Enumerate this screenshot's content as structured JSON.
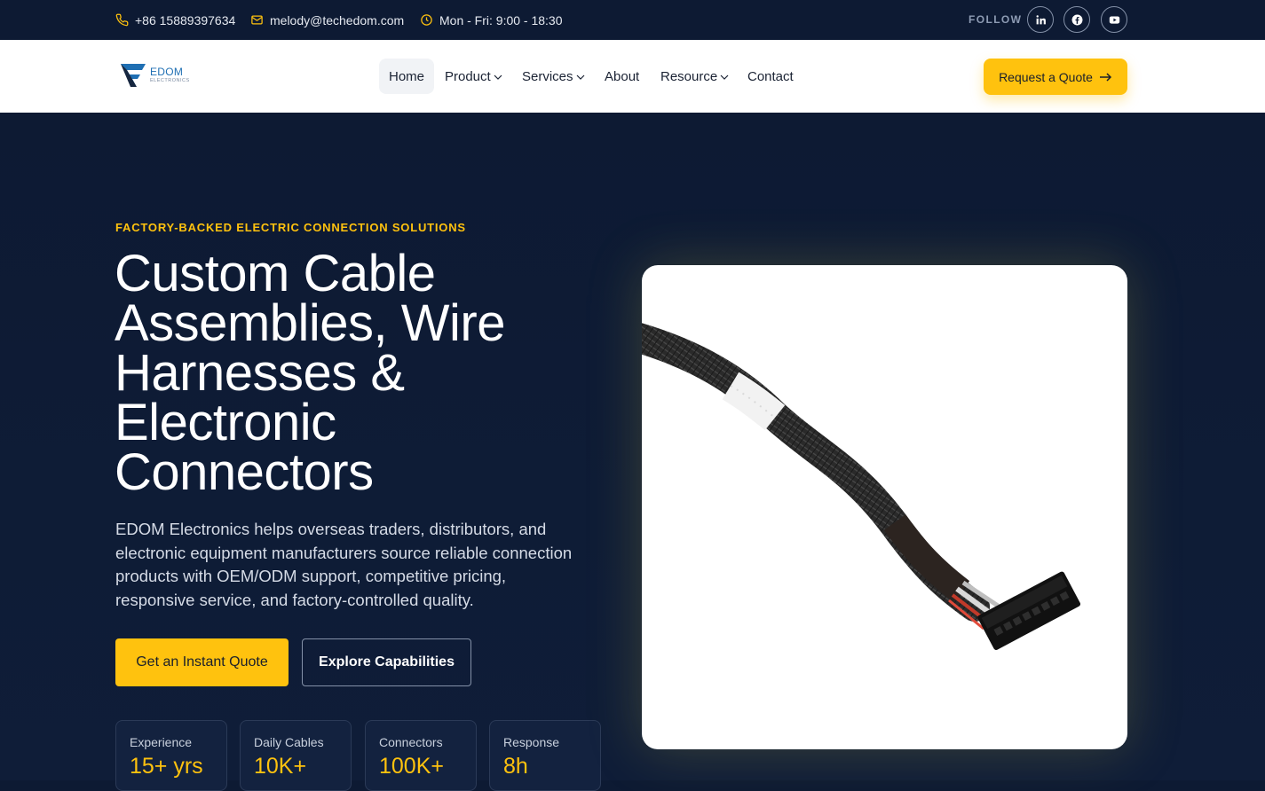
{
  "topbar": {
    "phone": "+86 15889397634",
    "email": "melody@techedom.com",
    "hours": "Mon - Fri: 9:00 - 18:30",
    "follow_label": "FOLLOW",
    "social": [
      "linkedin-icon",
      "facebook-icon",
      "youtube-icon"
    ]
  },
  "logo": {
    "name": "EDOM",
    "subtitle": "ELECTRONICS"
  },
  "nav": {
    "items": [
      {
        "label": "Home",
        "active": true
      },
      {
        "label": "Product",
        "dropdown": true
      },
      {
        "label": "Services",
        "dropdown": true
      },
      {
        "label": "About"
      },
      {
        "label": "Resource",
        "dropdown": true
      },
      {
        "label": "Contact"
      }
    ],
    "cta": "Request a Quote"
  },
  "hero": {
    "eyebrow": "FACTORY-BACKED ELECTRIC CONNECTION SOLUTIONS",
    "title_lines": [
      "Custom Cable",
      "Assemblies, Wire",
      "Harnesses &",
      "Electronic",
      "Connectors"
    ],
    "description": "EDOM Electronics helps overseas traders, distributors, and electronic equipment manufacturers source reliable connection products with OEM/ODM support, competitive pricing, responsive service, and factory-controlled quality.",
    "primary_cta": "Get an Instant Quote",
    "secondary_cta": "Explore Capabilities",
    "stats": [
      {
        "label": "Experience",
        "value": "15+ yrs"
      },
      {
        "label": "Daily Cables",
        "value": "10K+"
      },
      {
        "label": "Connectors",
        "value": "100K+"
      },
      {
        "label": "Response",
        "value": "8h"
      }
    ]
  },
  "colors": {
    "accent": "#ffc20e",
    "navy": "#0d1a33",
    "logo_blue": "#1f6fb3"
  }
}
